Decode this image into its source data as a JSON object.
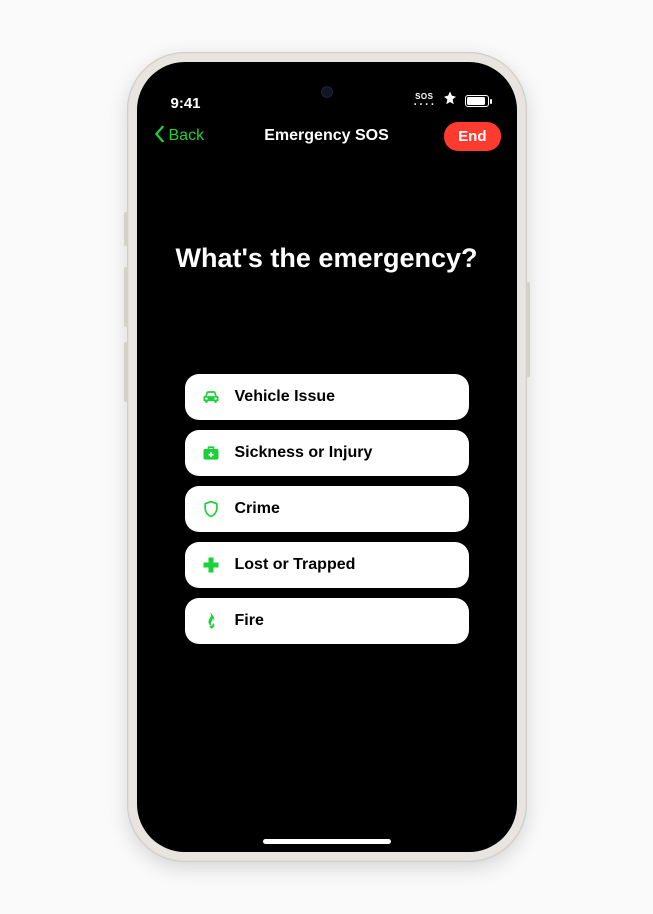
{
  "status": {
    "time": "9:41",
    "sos_label": "SOS"
  },
  "nav": {
    "back_label": "Back",
    "title": "Emergency SOS",
    "end_label": "End"
  },
  "heading": "What's the emergency?",
  "options": [
    {
      "id": "vehicle",
      "label": "Vehicle Issue",
      "icon": "car-icon"
    },
    {
      "id": "sickness",
      "label": "Sickness or Injury",
      "icon": "medkit-icon"
    },
    {
      "id": "crime",
      "label": "Crime",
      "icon": "shield-icon"
    },
    {
      "id": "lost",
      "label": "Lost or Trapped",
      "icon": "plus-icon"
    },
    {
      "id": "fire",
      "label": "Fire",
      "icon": "flame-icon"
    }
  ],
  "colors": {
    "accent_green": "#1bd13a",
    "accent_red": "#ff3b30",
    "background": "#000000",
    "option_bg": "#ffffff"
  }
}
